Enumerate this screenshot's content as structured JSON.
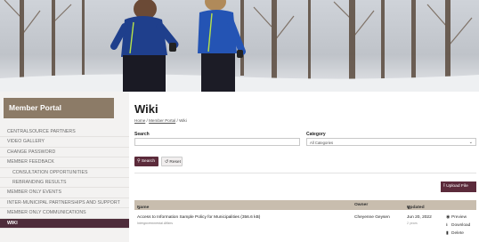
{
  "hero": {
    "icon": "joggers-winter-photo"
  },
  "sidebar": {
    "title": "Member Portal",
    "items": [
      {
        "label": "CENTRALSOURCE PARTNERS"
      },
      {
        "label": "VIDEO GALLERY"
      },
      {
        "label": "CHANGE PASSWORD"
      },
      {
        "label": "MEMBER FEEDBACK"
      },
      {
        "label": "CONSULTATION OPPORTUNITIES"
      },
      {
        "label": "REBRANDING RESULTS"
      },
      {
        "label": "MEMBER ONLY EVENTS"
      },
      {
        "label": "INTER-MUNICIPAL PARTNERSHIPS AND SUPPORT"
      },
      {
        "label": "MEMBER ONLY COMMUNICATIONS"
      },
      {
        "label": "WIKI"
      }
    ]
  },
  "main": {
    "title": "Wiki",
    "breadcrumb": {
      "home": "Home",
      "sep1": "/",
      "portal": "Member Portal",
      "sep2": "/",
      "current": "Wiki"
    },
    "search_label": "Search",
    "search_value": "",
    "category_label": "Category",
    "category_value": "All Categories",
    "search_button": "Search",
    "reset_button": "Reset",
    "upload_button": "Upload File"
  },
  "table": {
    "headers": {
      "name": "Name",
      "owner": "Owner",
      "updated": "Updated"
    },
    "rows": [
      {
        "title": "Access to Information Sample Policy for Municipalities (356.6 kB)",
        "category": "Intergovernmental Affairs",
        "owner": "Cheyenne Geysen",
        "date": "Jun 20, 2022",
        "ago": "2 years",
        "actions": {
          "preview": "Preview",
          "download": "Download",
          "delete": "Delete"
        }
      }
    ]
  },
  "colors": {
    "accent": "#5c2b3b",
    "sidebar_active": "#4e2c3a",
    "portal_title_bg": "#8c7b67",
    "table_header_bg": "#c8bdae"
  }
}
